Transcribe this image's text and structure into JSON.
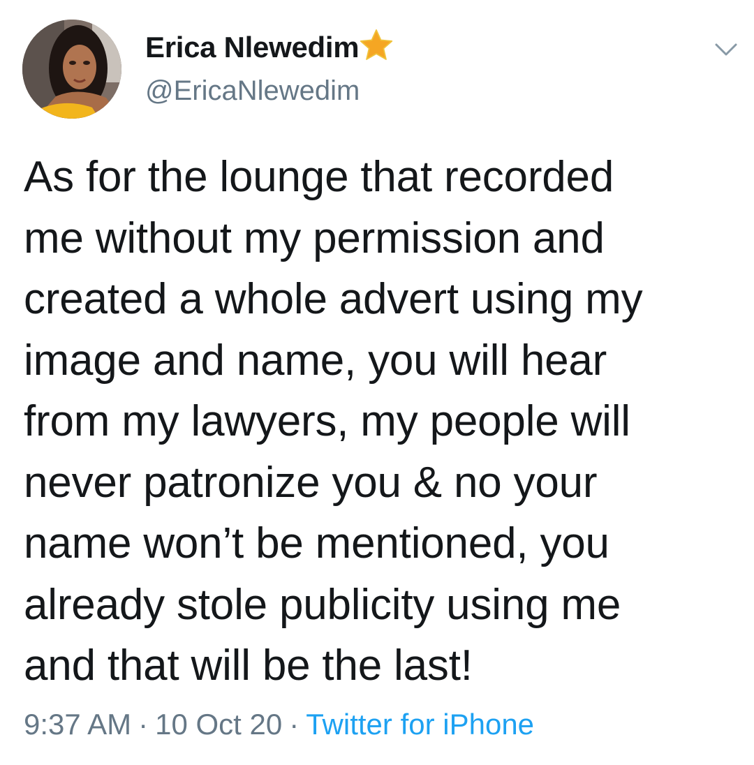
{
  "tweet": {
    "author": {
      "display_name": "Erica Nlewedim",
      "badge_icon": "star-icon",
      "handle": "@EricaNlewedim"
    },
    "text": "As for the lounge that recorded\nme without my permission and\ncreated a whole advert using my\nimage and name, you will hear\nfrom my lawyers, my people will\nnever patronize you & no your\nname won’t be mentioned, you\nalready stole publicity using me\nand that will be the last!",
    "meta": {
      "time": "9:37 AM",
      "separator": "·",
      "date": "10 Oct 20",
      "source": "Twitter for iPhone"
    },
    "menu_icon": "chevron-down-icon"
  },
  "colors": {
    "text_primary": "#14171a",
    "text_secondary": "#657786",
    "link": "#1da1f2",
    "star": "#f5a623",
    "avatar_shirt": "#f2b51c"
  }
}
